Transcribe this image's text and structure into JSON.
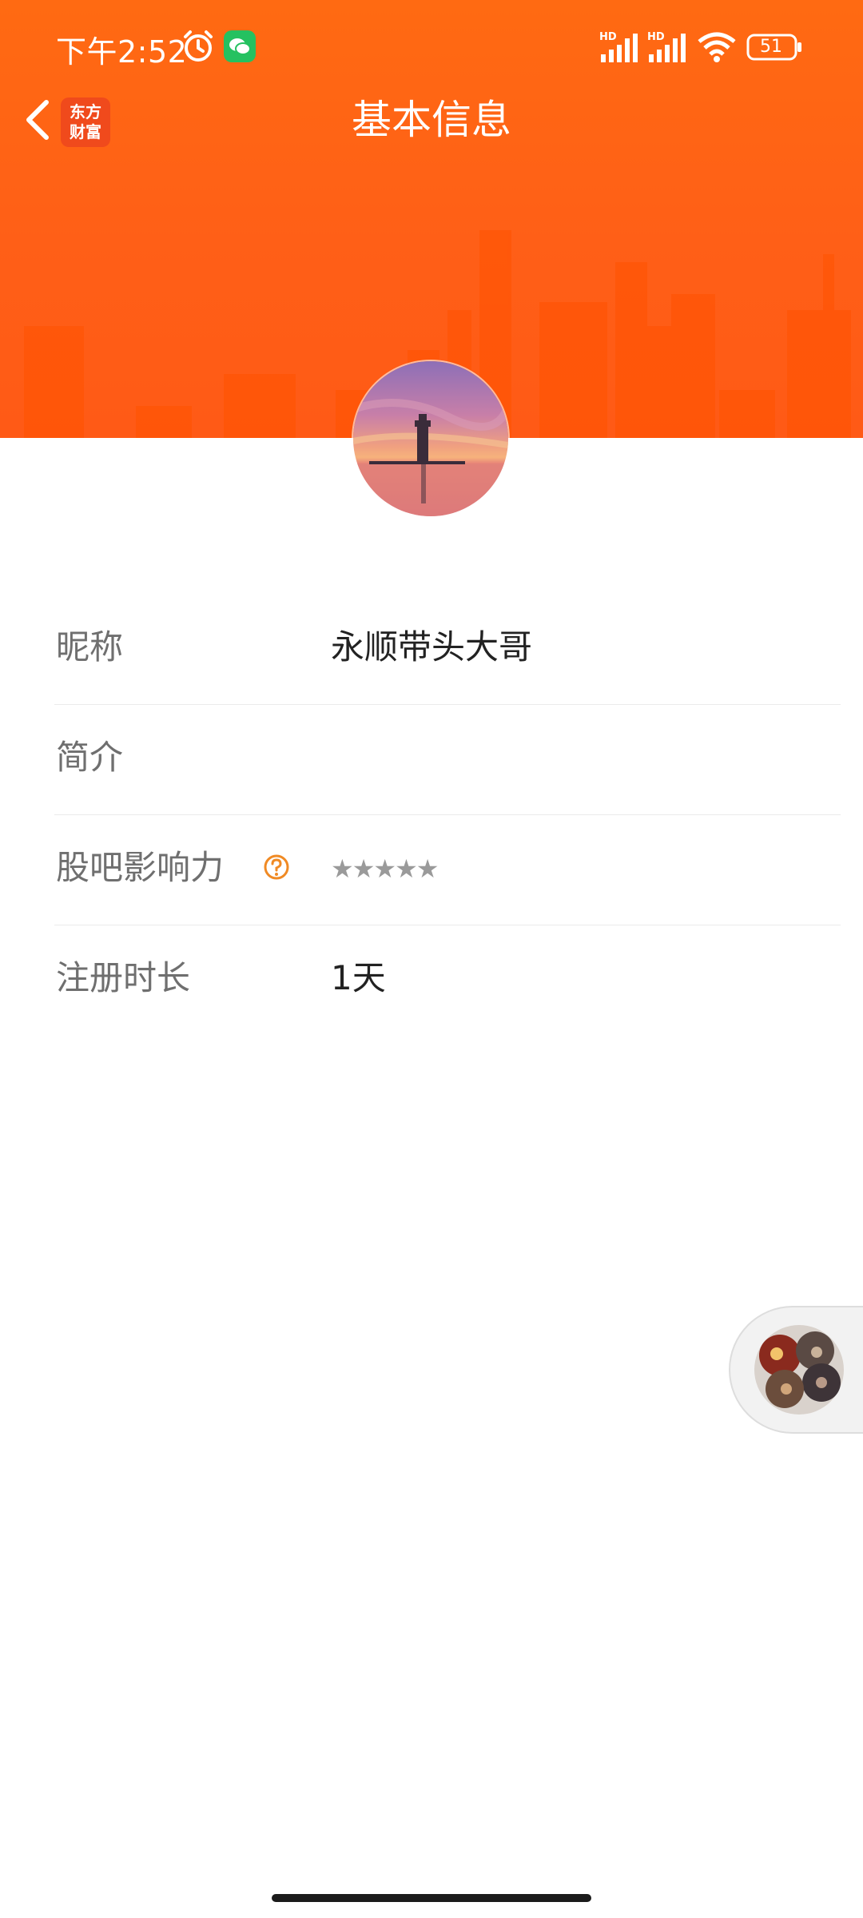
{
  "status_bar": {
    "time": "下午2:52",
    "battery": "51",
    "icons": [
      "alarm-icon",
      "wechat-icon",
      "hd-signal-icon",
      "hd-signal-icon",
      "wifi-icon",
      "battery-icon"
    ]
  },
  "nav": {
    "title": "基本信息",
    "back_icon": "chevron-left-icon",
    "logo_line1": "东方",
    "logo_line2": "财富"
  },
  "profile": {
    "rows": [
      {
        "label": "昵称",
        "value": "永顺带头大哥"
      },
      {
        "label": "简介",
        "value": ""
      },
      {
        "label": "股吧影响力",
        "value": "★★★★★",
        "help_icon": "question-circle-icon",
        "stars": 0
      },
      {
        "label": "注册时长",
        "value": "1天"
      }
    ]
  },
  "colors": {
    "header": "#ff6612",
    "accent": "#f08a24",
    "label": "#6f6f6f",
    "value": "#222222",
    "divider": "#ebebeb"
  }
}
